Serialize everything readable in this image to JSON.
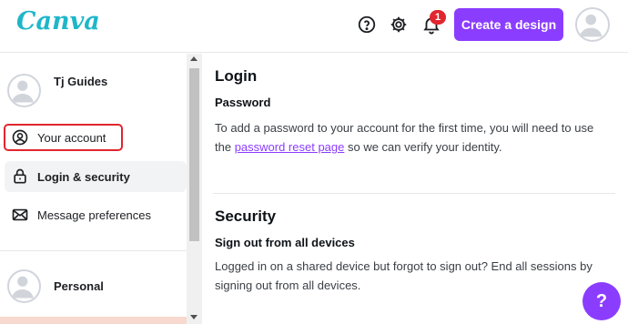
{
  "brand": {
    "logo_text": "Canva",
    "logo_color": "#1fb6c9",
    "accent": "#8b3dff"
  },
  "header": {
    "create_button": "Create a design",
    "notification_count": "1",
    "icons": [
      "help-circle-icon",
      "gear-icon",
      "bell-icon",
      "avatar"
    ]
  },
  "sidebar": {
    "user_name": "Tj Guides",
    "items": [
      {
        "label": "Your account",
        "icon": "user-circle-icon",
        "highlighted": true
      },
      {
        "label": "Login & security",
        "icon": "lock-icon",
        "active": true
      },
      {
        "label": "Message preferences",
        "icon": "envelope-icon"
      }
    ],
    "team_name": "Personal"
  },
  "main": {
    "login": {
      "title": "Login",
      "subtitle": "Password",
      "text_before_link": "To add a password to your account for the first time, you will need to use the ",
      "link_text": "password reset page",
      "text_after_link": " so we can verify your identity."
    },
    "security": {
      "title": "Security",
      "subtitle": "Sign out from all devices",
      "text": "Logged in on a shared device but forgot to sign out? End all sessions by signing out from all devices."
    }
  },
  "help_fab": {
    "label": "?"
  }
}
